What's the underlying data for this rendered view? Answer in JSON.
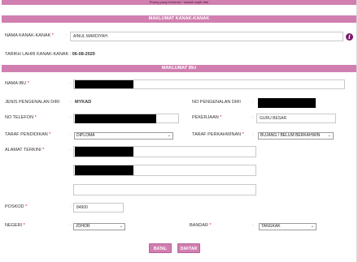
{
  "top_note": "Ruang yang bertanda * adalah wajib diisi",
  "child_section": {
    "title": "MAKLUMAT KANAK-KANAK",
    "name_label": "NAMA KANAK-KANAK",
    "name_value": "AINUL MARDIYAH",
    "dob_label": "TARIKH LAHIR KANAK-KANAK",
    "dob_value": "06-08-2020"
  },
  "mother_section": {
    "title": "MAKLUMAT IBU",
    "name_label": "NAMA IBU",
    "id_type_label": "JENIS PENGENALAN DIRI",
    "id_type_value": "MYKAD",
    "id_no_label": "NO PENGENALAN DIRI",
    "phone_label": "NO TELEFON",
    "job_label": "PEKERJAAN",
    "job_value": "GURU BESAR",
    "education_label": "TARAF PENDIDIKAN",
    "education_value": "DIPLOMA",
    "marital_label": "TARAF PERKAHWINAN",
    "marital_value": "BUJANG / BELUM BERKAHWIN",
    "address_label": "ALAMAT TERKINI",
    "postcode_label": "POSKOD",
    "postcode_value": "84900",
    "state_label": "NEGERI",
    "state_value": "JOHOR",
    "city_label": "BANDAR",
    "city_value": "TANGKAK"
  },
  "buttons": {
    "cancel": "BATAL",
    "register": "DAFTAR"
  },
  "asterisk": "*",
  "colon": ":",
  "icons": {
    "info": "i"
  },
  "colors": {
    "accent": "#d07fb0",
    "info_icon": "#7a1a6e"
  }
}
